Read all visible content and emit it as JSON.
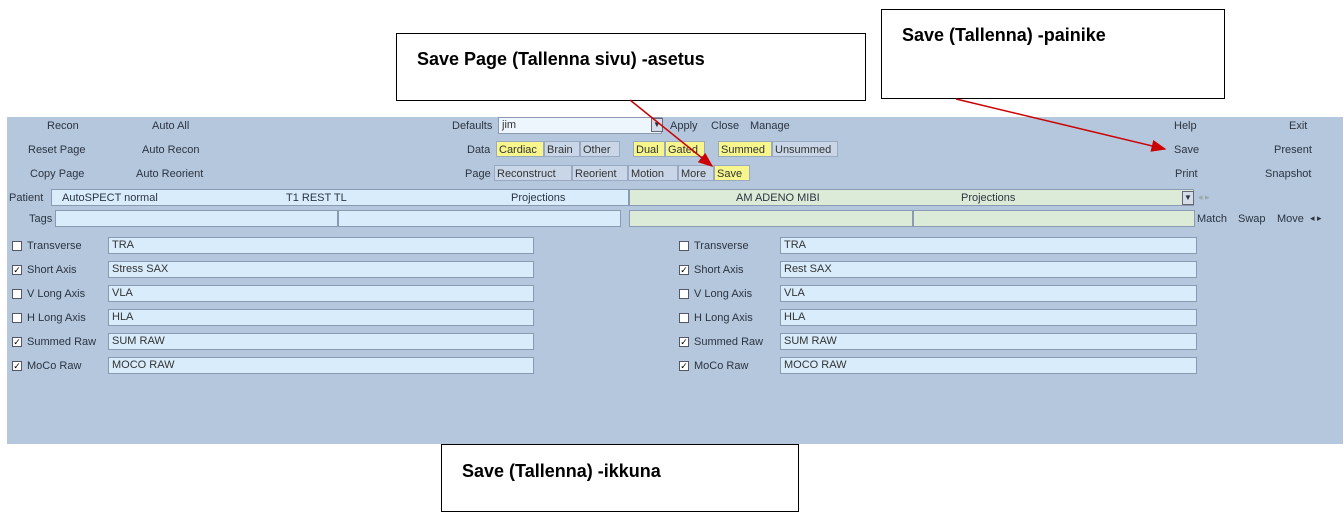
{
  "callouts": {
    "save_page": "Save Page (Tallenna sivu) -asetus",
    "save_button": "Save (Tallenna) -painike",
    "save_window": "Save (Tallenna) -ikkuna"
  },
  "colors": {
    "panel_bg": "#b4c7dc",
    "highlight": "#f6f68c",
    "arrow": "#cc0000",
    "input_bg": "#d8ecfb",
    "input_green_bg": "#dcebd8"
  },
  "left_buttons": [
    "Recon",
    "Auto All",
    "Reset Page",
    "Auto Recon",
    "Copy Page",
    "Auto Reorient"
  ],
  "defaults": {
    "label": "Defaults",
    "value": "jim",
    "apply": "Apply",
    "close": "Close",
    "manage": "Manage"
  },
  "data_row": {
    "label": "Data",
    "items": [
      "Cardiac",
      "Brain",
      "Other",
      "Dual",
      "Gated",
      "Summed",
      "Unsummed"
    ]
  },
  "page_row": {
    "label": "Page",
    "items": [
      "Reconstruct",
      "Reorient",
      "Motion",
      "More",
      "Save"
    ]
  },
  "right_buttons": [
    "Help",
    "Exit",
    "Save",
    "Present",
    "Print",
    "Snapshot"
  ],
  "patient": {
    "label": "Patient",
    "name": "AutoSPECT normal",
    "study1": "T1 REST TL",
    "type1": "Projections",
    "study2": "AM ADENO MIBI",
    "type2": "Projections"
  },
  "tags": {
    "label": "Tags",
    "match": "Match",
    "swap": "Swap",
    "move": "Move"
  },
  "left_series": [
    {
      "label": "Transverse",
      "checked": false,
      "value": "TRA"
    },
    {
      "label": "Short Axis",
      "checked": true,
      "value": "Stress SAX"
    },
    {
      "label": "V Long Axis",
      "checked": false,
      "value": "VLA"
    },
    {
      "label": "H Long Axis",
      "checked": false,
      "value": "HLA"
    },
    {
      "label": "Summed Raw",
      "checked": true,
      "value": "SUM RAW"
    },
    {
      "label": "MoCo Raw",
      "checked": true,
      "value": "MOCO RAW"
    }
  ],
  "right_series": [
    {
      "label": "Transverse",
      "checked": false,
      "value": "TRA"
    },
    {
      "label": "Short Axis",
      "checked": true,
      "value": "Rest SAX"
    },
    {
      "label": "V Long Axis",
      "checked": false,
      "value": "VLA"
    },
    {
      "label": "H Long Axis",
      "checked": false,
      "value": "HLA"
    },
    {
      "label": "Summed Raw",
      "checked": true,
      "value": "SUM RAW"
    },
    {
      "label": "MoCo Raw",
      "checked": true,
      "value": "MOCO RAW"
    }
  ]
}
